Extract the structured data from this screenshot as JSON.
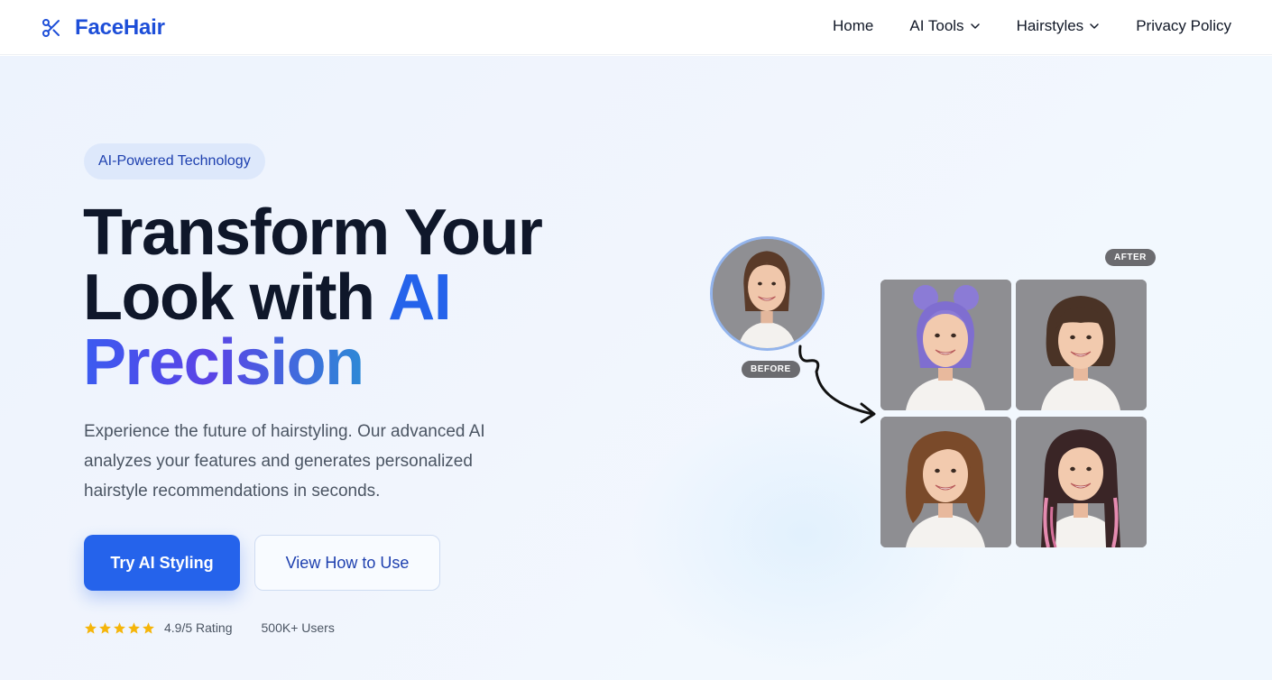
{
  "header": {
    "logo_text": "FaceHair",
    "logo_icon": "scissors-icon",
    "nav": [
      {
        "label": "Home"
      },
      {
        "label": "AI Tools",
        "icon": "chevron-down-icon"
      },
      {
        "label": "Hairstyles",
        "icon": "chevron-down-icon"
      },
      {
        "label": "Privacy Policy"
      }
    ]
  },
  "hero": {
    "badge": "AI-Powered Technology",
    "headline_line1": "Transform Your",
    "headline_line2_part1": "Look with ",
    "headline_line2_accent": "AI",
    "headline_line3": "Precision",
    "description": "Experience the future of hairstyling. Our advanced AI analyzes your features and generates personalized hairstyle recommendations in seconds.",
    "primary_button": "Try AI Styling",
    "secondary_button": "View How to Use",
    "rating_stars": 5,
    "rating_text": "4.9/5 Rating",
    "users_text": "500K+ Users"
  },
  "illustration": {
    "before_tag": "BEFORE",
    "after_tag": "AFTER",
    "styles": [
      {
        "name": "purple space buns",
        "hair_color": "#8b7bd6"
      },
      {
        "name": "brown bob with bangs",
        "hair_color": "#4a3326"
      },
      {
        "name": "wavy brown lob",
        "hair_color": "#7a4a2a"
      },
      {
        "name": "long waves with pink highlights",
        "hair_color": "#3a2526"
      }
    ]
  },
  "colors": {
    "brand": "#1d4ed8",
    "primary": "#2563eb",
    "star": "#f5b50a"
  }
}
